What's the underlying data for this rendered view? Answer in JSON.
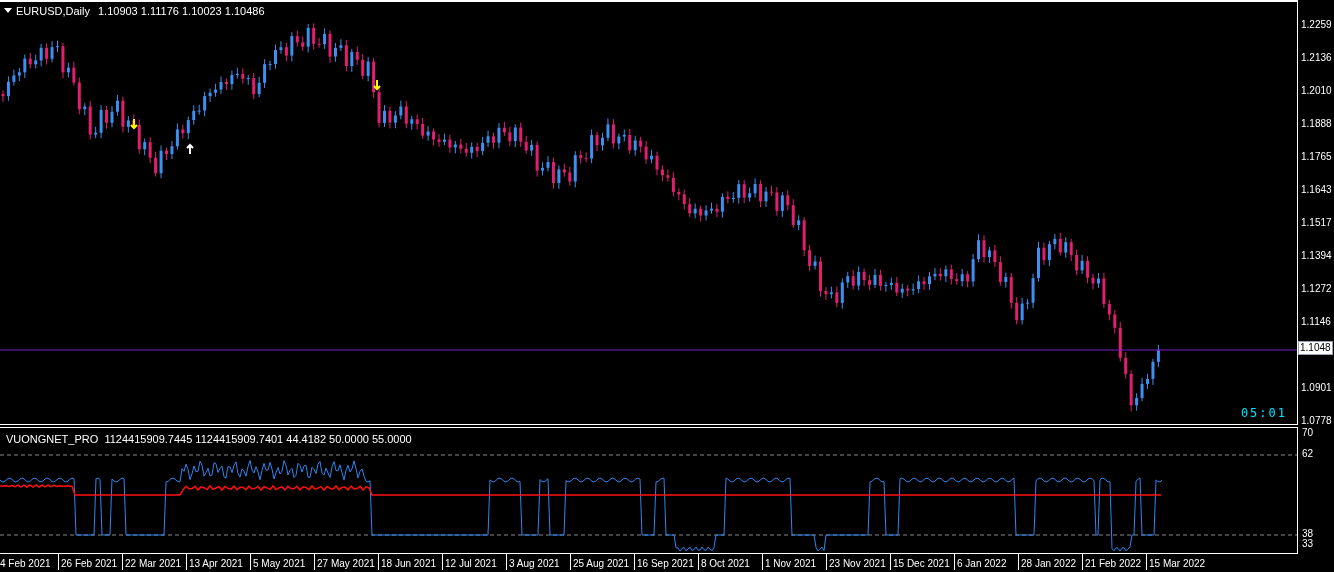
{
  "chart_header": {
    "symbol": "EURUSD,Daily",
    "ohlc": "1.10903 1.11176 1.10023 1.10486"
  },
  "price_axis": [
    "1.2259",
    "1.2136",
    "1.2010",
    "1.1888",
    "1.1765",
    "1.1643",
    "1.1517",
    "1.1394",
    "1.1272",
    "1.1146",
    "1.0901",
    "1.0778"
  ],
  "current_price": "1.1048",
  "timer": "05:01",
  "indicator": {
    "header": "VUONGNET_PRO  1124415909.7445 1124415909.7401 44.4182 50.0000 55.0000",
    "axis": [
      "70",
      "62",
      "38",
      "33"
    ]
  },
  "time_axis": [
    "4 Feb 2021",
    "26 Feb 2021",
    "22 Mar 2021",
    "13 Apr 2021",
    "5 May 2021",
    "27 May 2021",
    "18 Jun 2021",
    "12 Jul 2021",
    "3 Aug 2021",
    "25 Aug 2021",
    "16 Sep 2021",
    "8 Oct 2021",
    "1 Nov 2021",
    "23 Nov 2021",
    "15 Dec 2021",
    "6 Jan 2022",
    "28 Jan 2022",
    "21 Feb 2022",
    "15 Mar 2022"
  ]
}
